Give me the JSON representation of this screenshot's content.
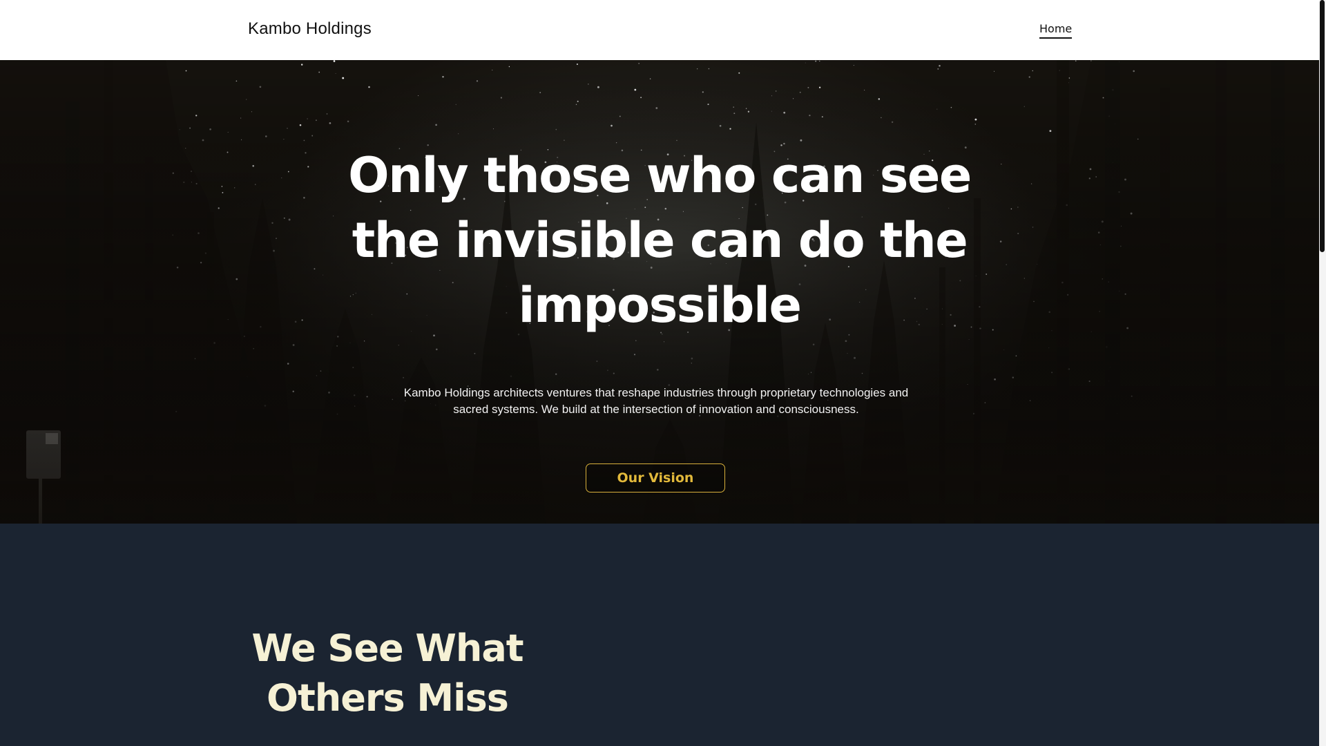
{
  "header": {
    "site_title": "Kambo Holdings",
    "nav": {
      "home_label": "Home"
    }
  },
  "hero": {
    "headline": "Only those who can see the invisible can do the impossible",
    "subtext": "Kambo Holdings architects ventures that reshape industries through proprietary technologies and sacred systems. We build at the intersection of innovation and consciousness.",
    "cta_label": "Our Vision",
    "background_image": "night-sky-forest"
  },
  "about": {
    "heading": "We See What Others Miss"
  },
  "colors": {
    "accent_gold": "#d9b13b",
    "heading_cream": "#f6f1d5",
    "section_navy": "#1b2431",
    "header_bg": "#ffffff"
  }
}
